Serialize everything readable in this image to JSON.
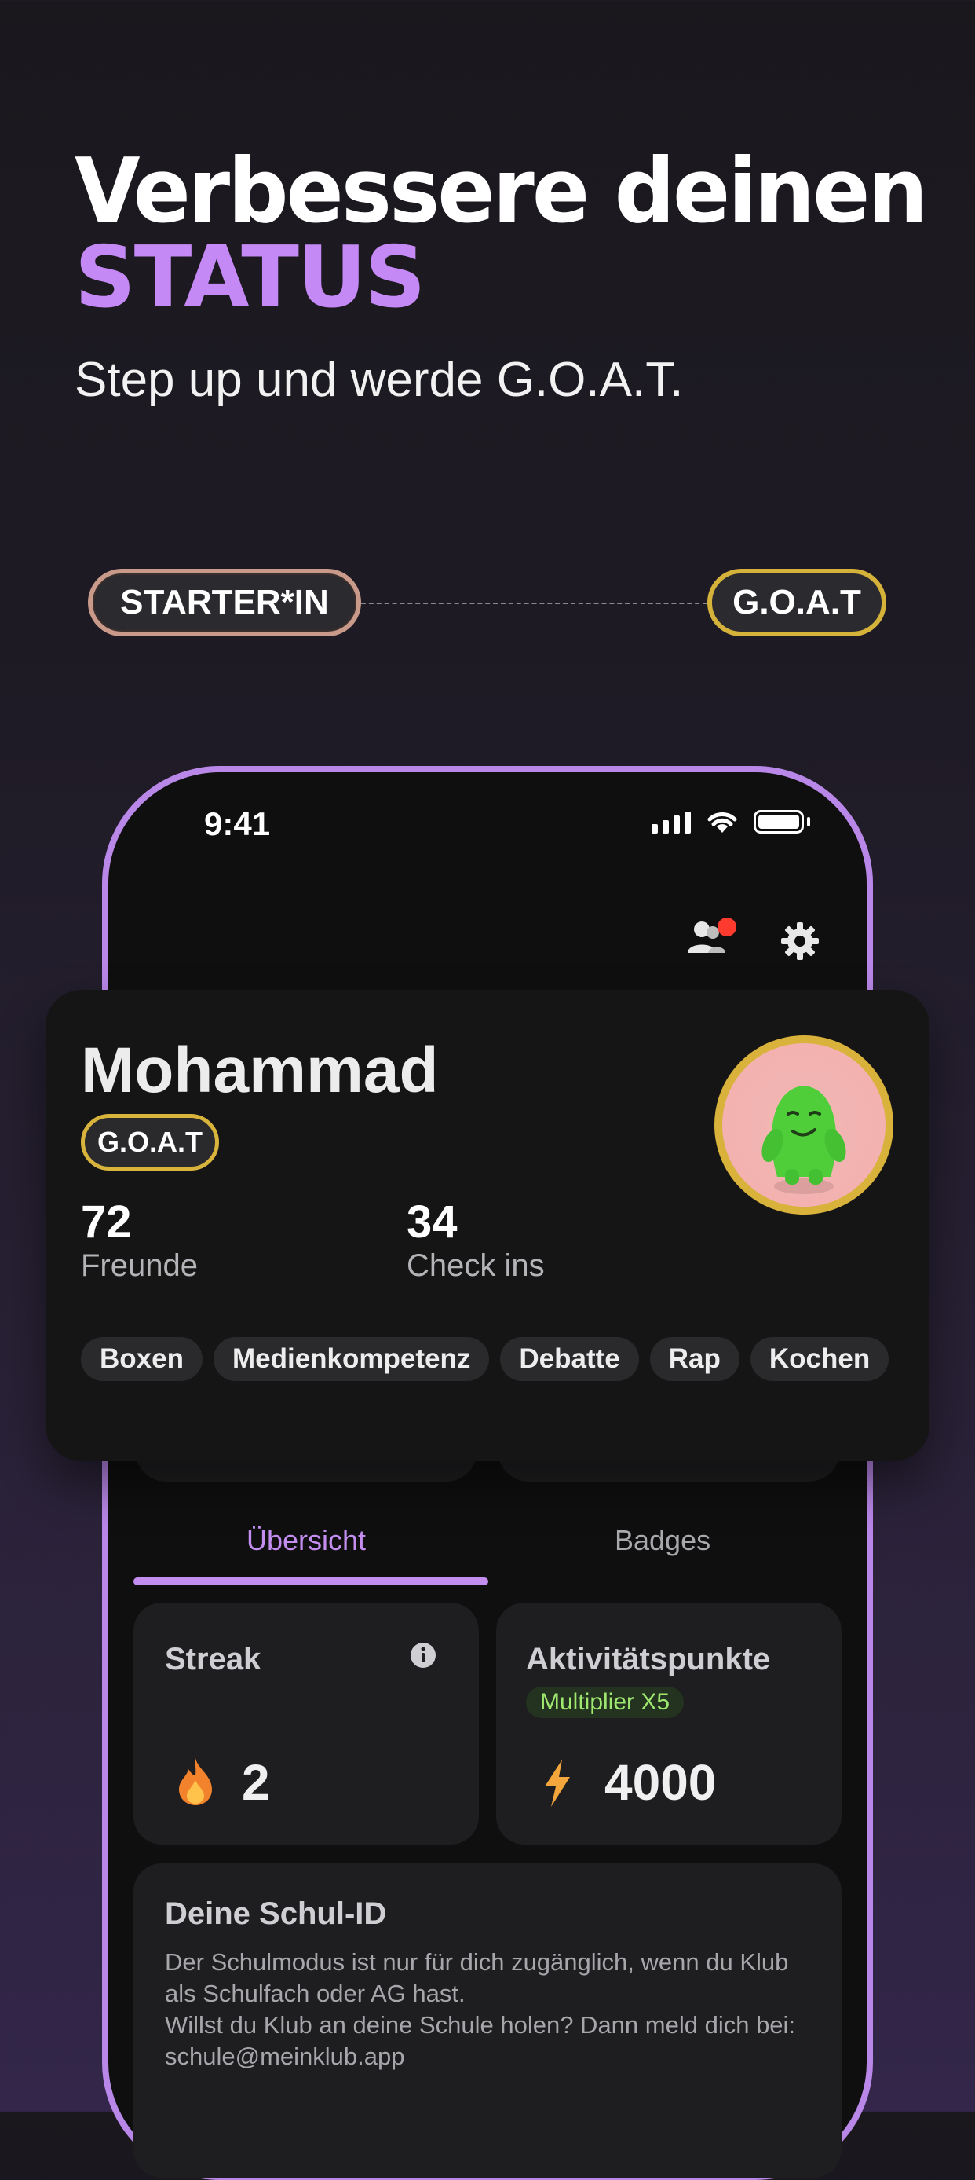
{
  "hero": {
    "title_line1": "Verbessere deinen",
    "title_line2": "STATUS",
    "subtitle": "Step up und werde G.O.A.T."
  },
  "status_track": {
    "start_label": "STARTER*IN",
    "end_label": "G.O.A.T"
  },
  "phone": {
    "status_bar": {
      "time": "9:41"
    },
    "header_icons": [
      "friends-icon",
      "gear-icon"
    ],
    "profile": {
      "name": "Mohammad",
      "rank_badge": "G.O.A.T",
      "stats": [
        {
          "value": "72",
          "label": "Freunde"
        },
        {
          "value": "34",
          "label": "Check ins"
        }
      ],
      "tags": [
        "Boxen",
        "Medienkompetenz",
        "Debatte",
        "Rap",
        "Kochen"
      ]
    },
    "tabs": [
      {
        "label": "Übersicht",
        "active": true
      },
      {
        "label": "Badges",
        "active": false
      }
    ],
    "tiles": {
      "streak": {
        "title": "Streak",
        "value": "2",
        "icon": "flame-icon"
      },
      "activity": {
        "title": "Aktivitätspunkte",
        "multiplier": "Multiplier X5",
        "value": "4000",
        "icon": "bolt-icon"
      }
    },
    "school_id": {
      "title": "Deine Schul-ID",
      "text": "Der Schulmodus ist nur für dich zugänglich, wenn du Klub als Schulfach oder AG hast.\nWillst du Klub an deine Schule holen? Dann meld dich bei: schule@meinklub.app"
    }
  },
  "colors": {
    "accent_purple": "#c489f4",
    "goat_gold": "#d8b23b",
    "starter_bronze": "#c99a8a",
    "multiplier_green": "#9fe870"
  }
}
